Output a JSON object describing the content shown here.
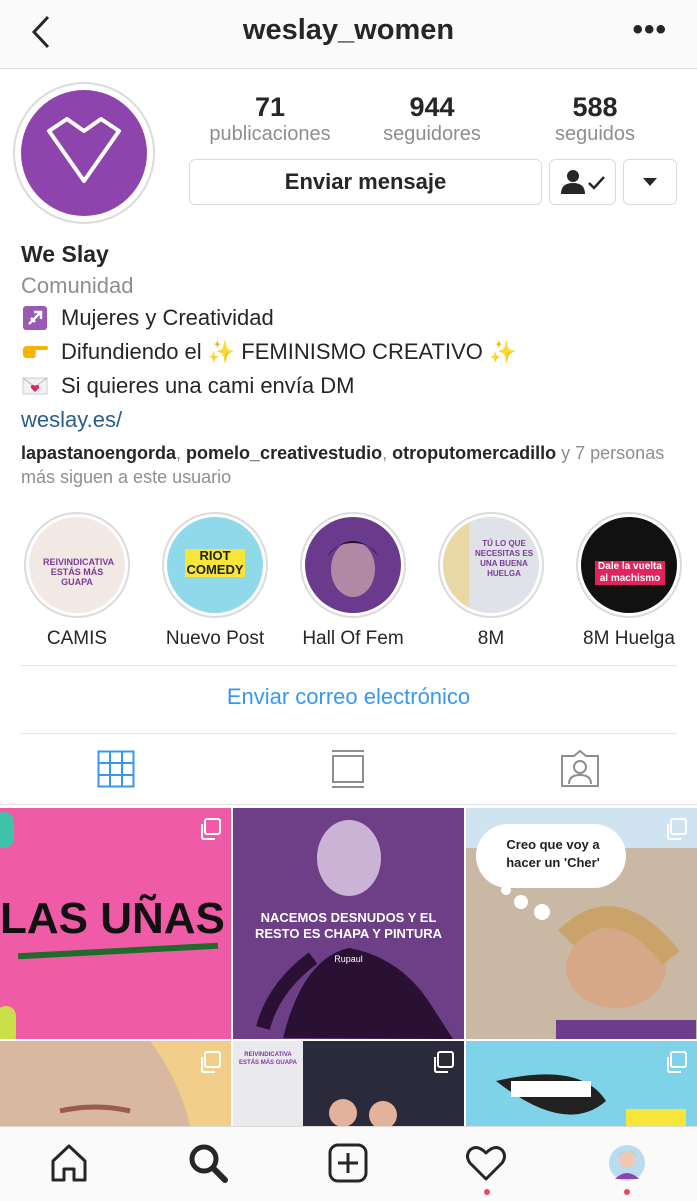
{
  "header": {
    "username": "weslay_women"
  },
  "profile": {
    "stats": [
      {
        "value": "71",
        "label": "publicaciones"
      },
      {
        "value": "944",
        "label": "seguidores"
      },
      {
        "value": "588",
        "label": "seguidos"
      }
    ],
    "message_button": "Enviar mensaje",
    "name": "We Slay",
    "category": "Comunidad",
    "bio_lines": [
      {
        "emoji": "sagittarius-icon",
        "text": "Mujeres y Creatividad"
      },
      {
        "emoji": "pointing-hand-icon",
        "text": "Difundiendo el ✨ FEMINISMO CREATIVO ✨"
      },
      {
        "emoji": "love-letter-icon",
        "text": "Si quieres una cami envía DM"
      }
    ],
    "website": "weslay.es/",
    "followed_by": {
      "users": [
        "lapastanoengorda",
        "pomelo_creativestudio",
        "otroputomercadillo"
      ],
      "sep": ", ",
      "rest": " y 7 personas más siguen a este usuario"
    }
  },
  "highlights": [
    {
      "label": "CAMIS",
      "text": "REIVINDICATIVA ESTÁS MÁS GUAPA"
    },
    {
      "label": "Nuevo Post",
      "text": "RIOT COMEDY"
    },
    {
      "label": "Hall Of Fem",
      "text": ""
    },
    {
      "label": "8M",
      "text": "TÚ LO QUE NECESITAS ES UNA BUENA HUELGA"
    },
    {
      "label": "8M Huelga",
      "text": "Dale la vuelta al machismo"
    }
  ],
  "email_button": "Enviar correo electrónico",
  "tabs": [
    "grid-icon",
    "feed-icon",
    "tagged-icon"
  ],
  "posts": [
    {
      "text": "LAS UÑAS",
      "bg": "#ef5ba7"
    },
    {
      "text": "NACEMOS DESNUDOS Y EL RESTO ES CHAPA Y PINTURA",
      "sub": "Rupaul",
      "bg": "#6c3f86"
    },
    {
      "text": "Creo que voy a hacer un 'Cher'",
      "bg": "#c9b8a4"
    },
    {
      "text": "",
      "bg": "#d8b8a0"
    },
    {
      "text": "REIVINDICATIVA ESTÁS MÁS GUAPA",
      "bg": "#2a2a3a"
    },
    {
      "text": "",
      "bg": "#7fd3e8"
    }
  ],
  "nav": [
    "home-icon",
    "search-icon",
    "new-post-icon",
    "activity-icon",
    "profile-icon"
  ],
  "colors": {
    "brand_purple": "#8e44ad",
    "link_blue": "#3897f0",
    "notification": "#ed4956"
  }
}
